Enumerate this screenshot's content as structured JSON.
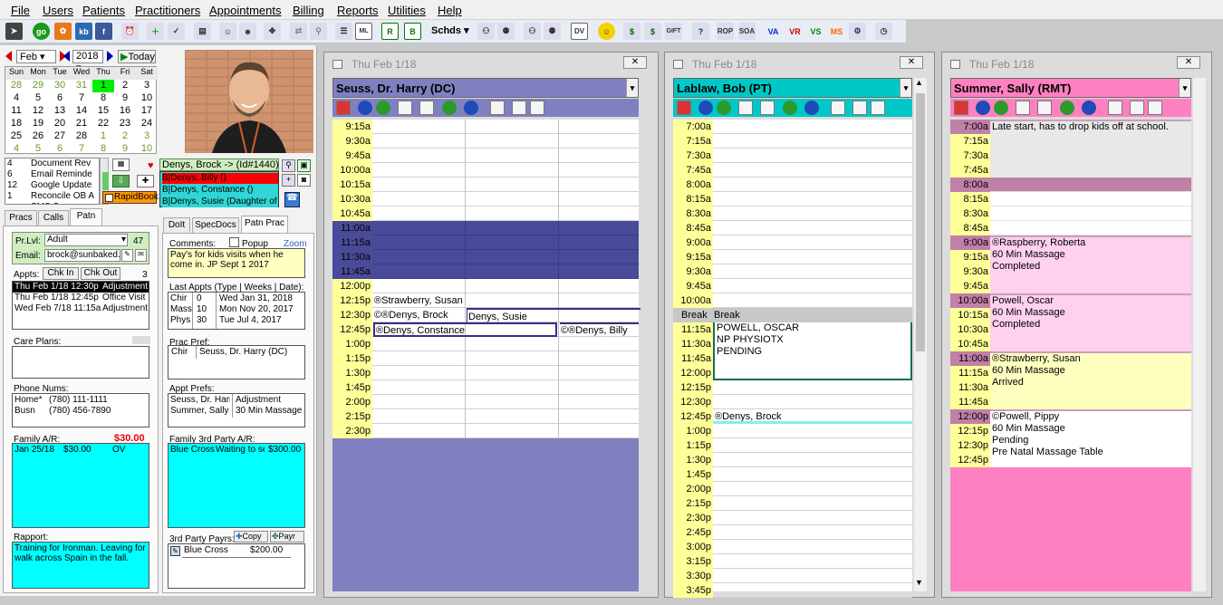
{
  "menu": [
    "File",
    "Users",
    "Patients",
    "Practitioners",
    "Appointments",
    "Billing",
    "Reports",
    "Utilities",
    "Help"
  ],
  "toolbar": {
    "schds_label": "Schds",
    "rop": "ROP",
    "soa": "SOA",
    "va": "VA",
    "vr": "VR",
    "vs": "VS",
    "ms": "MS",
    "go": "go",
    "kb": "kb",
    "ml": "ML",
    "dv": "DV",
    "gift": "GIFT",
    "icon_colors": {
      "va": "#0033cc",
      "vr": "#cc0000",
      "vs": "#008800",
      "ms": "#ff6600"
    }
  },
  "calendar": {
    "month": "Feb",
    "year": "2018",
    "today_label": "Today",
    "headers": [
      "Sun",
      "Mon",
      "Tue",
      "Wed",
      "Thu",
      "Fri",
      "Sat"
    ],
    "weeks": [
      [
        "28",
        "29",
        "30",
        "31",
        "1",
        "2",
        "3"
      ],
      [
        "4",
        "5",
        "6",
        "7",
        "8",
        "9",
        "10"
      ],
      [
        "11",
        "12",
        "13",
        "14",
        "15",
        "16",
        "17"
      ],
      [
        "18",
        "19",
        "20",
        "21",
        "22",
        "23",
        "24"
      ],
      [
        "25",
        "26",
        "27",
        "28",
        "1",
        "2",
        "3"
      ],
      [
        "4",
        "5",
        "6",
        "7",
        "8",
        "9",
        "10"
      ]
    ],
    "selected": "1"
  },
  "waitlist": [
    {
      "n": "4",
      "text": "Document Rev"
    },
    {
      "n": "6",
      "text": "Email Reminde"
    },
    {
      "n": "12",
      "text": "Google Update"
    },
    {
      "n": "1",
      "text": "Reconcile OB A"
    },
    {
      "n": "",
      "text": "SMS S..."
    }
  ],
  "patient": {
    "selector": "Denys, Brock -> (Id#1440)",
    "family": [
      {
        "text": "B|Denys, Billy ()",
        "color": "#ff0000"
      },
      {
        "text": "B|Denys, Constance ()",
        "color": "#30d5d5"
      },
      {
        "text": "B|Denys, Susie (Daughter of P",
        "color": "#30d5d5"
      }
    ],
    "rapidbook": "RapidBook"
  },
  "left_tabs": [
    "Pracs",
    "Calls",
    "Patn"
  ],
  "mid_tabs": [
    "DoIt",
    "SpecDocs",
    "Patn Prac"
  ],
  "patn": {
    "prlvl_label": "Pr.Lvl:",
    "prlvl_value": "Adult",
    "prlvl_count": "47",
    "email_label": "Email:",
    "email_value": "brock@sunbaked.c",
    "appts_label": "Appts:",
    "chk_in": "Chk In",
    "chk_out": "Chk Out",
    "appt_count": "3",
    "appts": [
      {
        "when": "Thu Feb 1/18 12:30p",
        "type": "Adjustment",
        "sel": true
      },
      {
        "when": "Thu Feb 1/18 12:45p",
        "type": "Office Visit",
        "sel": false
      },
      {
        "when": "Wed Feb 7/18 11:15a",
        "type": "Adjustment",
        "sel": false
      }
    ],
    "care_plans_label": "Care Plans:",
    "phone_label": "Phone Nums:",
    "phones": [
      {
        "type": "Home*",
        "num": "(780) 111-1111"
      },
      {
        "type": "Busn",
        "num": "(780) 456-7890"
      }
    ],
    "family_ar_label": "Family A/R:",
    "family_ar_total": "$30.00",
    "family_ar": [
      {
        "date": "Jan 25/18",
        "amt": "$30.00",
        "code": "OV"
      }
    ],
    "rapport_label": "Rapport:",
    "rapport": "Training for Ironman.  Leaving for walk across Spain in the fall."
  },
  "patnprac": {
    "comments_label": "Comments:",
    "popup_label": "Popup",
    "zoom_label": "Zoom",
    "comments": "Pay's for kids visits when he come in. JP Sept 1 2017",
    "last_appts_label": "Last Appts (Type | Weeks | Date):",
    "last_appts": [
      {
        "t": "Chir",
        "w": "0",
        "d": "Wed Jan 31, 2018"
      },
      {
        "t": "Mass",
        "w": "10",
        "d": "Mon Nov 20, 2017"
      },
      {
        "t": "Phys",
        "w": "30",
        "d": "Tue Jul 4, 2017"
      }
    ],
    "prac_pref_label": "Prac Pref:",
    "prac_pref": {
      "t": "Chir",
      "p": "Seuss, Dr. Harry (DC)"
    },
    "appt_prefs_label": "Appt Prefs:",
    "appt_prefs": [
      {
        "p": "Seuss, Dr. Harr",
        "t": "Adjustment"
      },
      {
        "p": "Summer, Sally (",
        "t": "30 Min Massage"
      }
    ],
    "third_ar_label": "Family 3rd Party A/R:",
    "third_ar": [
      {
        "p": "Blue Cross",
        "s": "Waiting to se",
        "a": "$300.00"
      }
    ],
    "third_payrs_label": "3rd Party Payrs:",
    "copy": "Copy",
    "payr": "Payr",
    "payrs": [
      {
        "name": "Blue Cross",
        "amt": "$200.00"
      }
    ]
  },
  "schedules": [
    {
      "date": "Thu Feb 1/18",
      "prac": "Seuss, Dr. Harry (DC)",
      "prac_color": "#8080c0",
      "times": [
        "9:15a",
        "9:30a",
        "9:45a",
        "10:00a",
        "10:15a",
        "10:30a",
        "10:45a",
        "11:00a",
        "11:15a",
        "11:30a",
        "11:45a",
        "12:00p",
        "12:15p",
        "12:30p",
        "12:45p",
        "1:00p",
        "1:15p",
        "1:30p",
        "1:45p",
        "2:00p",
        "2:15p",
        "2:30p"
      ],
      "appts": [
        {
          "text": "®Strawberry, Susan"
        },
        {
          "text": "©®Denys, Brock"
        },
        {
          "text": "Denys, Susie"
        },
        {
          "text": "®Denys, Constance"
        },
        {
          "text": "©®Denys, Billy"
        }
      ]
    },
    {
      "date": "Thu Feb 1/18",
      "prac": "Lablaw, Bob (PT)",
      "prac_color": "#00c8c8",
      "times": [
        "7:00a",
        "7:15a",
        "7:30a",
        "7:45a",
        "8:00a",
        "8:15a",
        "8:30a",
        "8:45a",
        "9:00a",
        "9:15a",
        "9:30a",
        "9:45a",
        "10:00a",
        "Break",
        "11:15a",
        "11:30a",
        "11:45a",
        "12:00p",
        "12:15p",
        "12:30p",
        "12:45p",
        "1:00p",
        "1:15p",
        "1:30p",
        "1:45p",
        "2:00p",
        "2:15p",
        "2:30p",
        "2:45p",
        "3:00p",
        "3:15p",
        "3:30p",
        "3:45p"
      ],
      "break_label": "Break",
      "appts": [
        {
          "lines": [
            "POWELL, OSCAR",
            "NP PHYSIOTX",
            "PENDING"
          ]
        },
        {
          "lines": [
            "®Denys, Brock"
          ]
        }
      ]
    },
    {
      "date": "Thu Feb 1/18",
      "prac": "Summer, Sally (RMT)",
      "prac_color": "#ff80c0",
      "times": [
        "7:00a",
        "7:15a",
        "7:30a",
        "7:45a",
        "8:00a",
        "8:15a",
        "8:30a",
        "8:45a",
        "9:00a",
        "9:15a",
        "9:30a",
        "9:45a",
        "10:00a",
        "10:15a",
        "10:30a",
        "10:45a",
        "11:00a",
        "11:15a",
        "11:30a",
        "11:45a",
        "12:00p",
        "12:15p",
        "12:30p",
        "12:45p"
      ],
      "appts": [
        {
          "lines": [
            "Late start, has to drop kids off at school."
          ]
        },
        {
          "lines": [
            "®Raspberry, Roberta",
            "60 Min Massage",
            "Completed"
          ]
        },
        {
          "lines": [
            "Powell, Oscar",
            "60 Min Massage",
            "Completed"
          ]
        },
        {
          "lines": [
            "®Strawberry, Susan",
            "60 Min Massage",
            "Arrived"
          ]
        },
        {
          "lines": [
            "©Powell, Pippy",
            "60 Min Massage",
            "Pending",
            "Pre Natal Massage Table"
          ]
        }
      ]
    }
  ]
}
